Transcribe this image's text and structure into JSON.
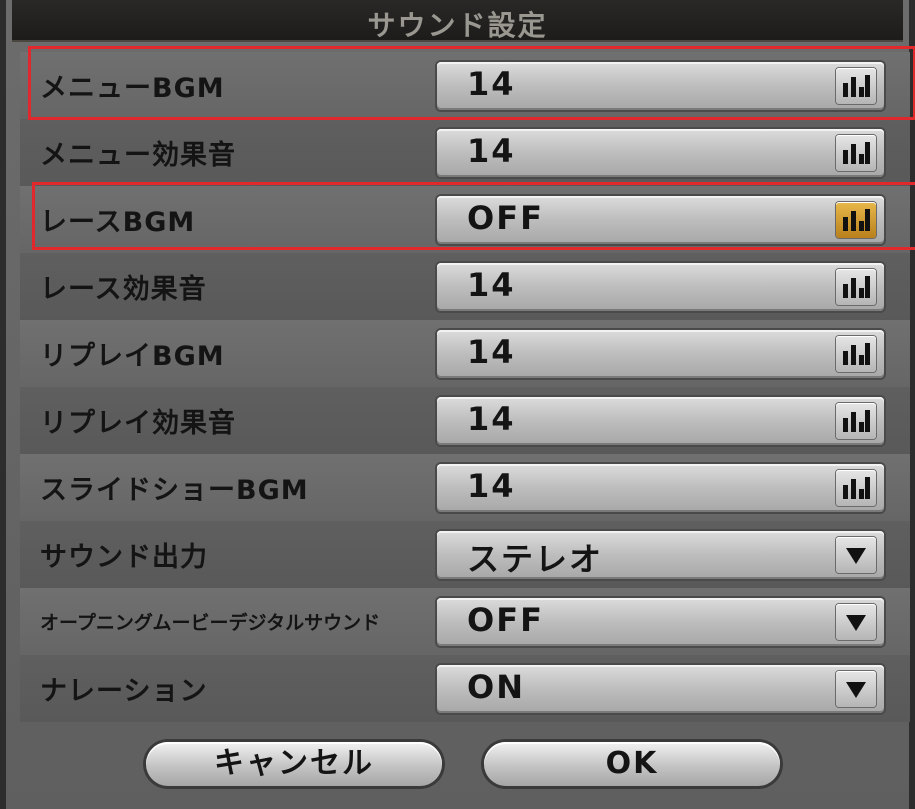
{
  "dialog": {
    "title": "サウンド設定"
  },
  "rows": [
    {
      "label": "メニューBGM",
      "value": "14",
      "control": "level",
      "highlighted": true
    },
    {
      "label": "メニュー効果音",
      "value": "14",
      "control": "level"
    },
    {
      "label": "レースBGM",
      "value": "OFF",
      "control": "level",
      "highlighted": true,
      "active": true
    },
    {
      "label": "レース効果音",
      "value": "14",
      "control": "level"
    },
    {
      "label": "リプレイBGM",
      "value": "14",
      "control": "level"
    },
    {
      "label": "リプレイ効果音",
      "value": "14",
      "control": "level"
    },
    {
      "label": "スライドショーBGM",
      "value": "14",
      "control": "level"
    },
    {
      "label": "サウンド出力",
      "value": "ステレオ",
      "control": "dropdown"
    },
    {
      "label": "オープニングムービーデジタルサウンド",
      "value": "OFF",
      "control": "dropdown"
    },
    {
      "label": "ナレーション",
      "value": "ON",
      "control": "dropdown"
    }
  ],
  "buttons": {
    "cancel": "キャンセル",
    "ok": "OK"
  },
  "colors": {
    "highlight": "#e0282d",
    "active_accent": "#d89a2c",
    "cursor": "#e6b21e"
  }
}
